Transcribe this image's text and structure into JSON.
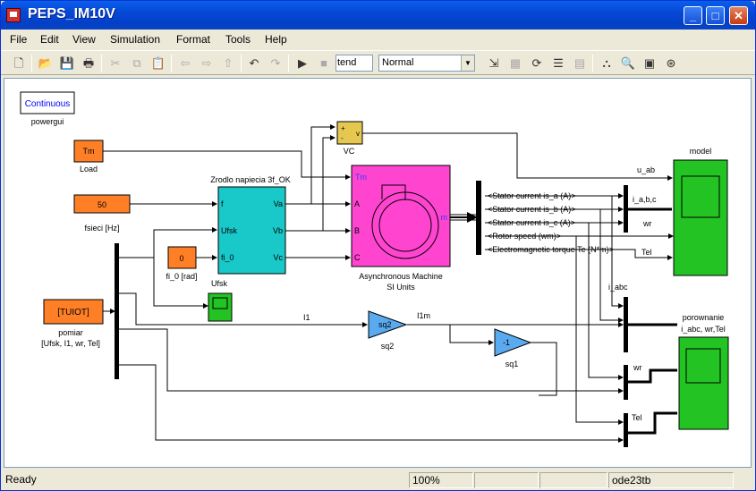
{
  "window": {
    "title": "PEPS_IM10V",
    "min_label": "_",
    "max_label": "□",
    "close_label": "✕"
  },
  "menu": [
    "File",
    "Edit",
    "View",
    "Simulation",
    "Format",
    "Tools",
    "Help"
  ],
  "toolbar": {
    "stop_time": "tend",
    "sim_mode": "Normal"
  },
  "blocks": {
    "powergui": {
      "text": "Continuous",
      "label": "powergui"
    },
    "load": {
      "text": "Tm",
      "label": "Load"
    },
    "fsieci": {
      "text": "50",
      "label": "fsieci [Hz]"
    },
    "fi0": {
      "text": "0",
      "label": "fi_0 [rad]"
    },
    "tuiot": {
      "text": "[TUIOT]",
      "label1": "pomiar",
      "label2": "[Ufsk, I1, wr, Tel]"
    },
    "vc": {
      "label": "VC",
      "plus": "+",
      "minus": "-",
      "v": "v"
    },
    "source": {
      "title": "Zrodlo napiecia 3f_OK",
      "in_f": "f",
      "in_ufsk": "Ufsk",
      "in_fi0": "fi_0",
      "out_va": "Va",
      "out_vb": "Vb",
      "out_vc": "Vc"
    },
    "machine": {
      "tm": "Tm",
      "a": "A",
      "b": "B",
      "c": "C",
      "m": "m",
      "label1": "Asynchronous Machine",
      "label2": "SI Units"
    },
    "ufsk_scope": {
      "label": "Ufsk"
    },
    "sq2": {
      "text": "sq2",
      "label": "sq2"
    },
    "sq1": {
      "text": "-1",
      "label": "sq1"
    },
    "model_scope": {
      "label": "model",
      "in1": "u_ab",
      "in2": "i_a,b,c",
      "in3": "wr",
      "in4": "Tel"
    },
    "por_scope": {
      "label1": "porownanie",
      "label2": "i_abc, wr,Tel"
    },
    "signals": {
      "s1": "<Stator current is_a (A)>",
      "s2": "<Stator current is_b (A)>",
      "s3": "<Stator current is_c (A)>",
      "s4": "<Rotor speed (wm)>",
      "s5": "<Electromagnetic torque Te (N*m)>",
      "i1": "I1",
      "i1m": "I1m",
      "iabc": "i_abc",
      "wr": "wr",
      "tel": "Tel"
    }
  },
  "status": {
    "ready": "Ready",
    "zoom": "100%",
    "solver": "ode23tb"
  },
  "colors": {
    "orange": "#ff7f27",
    "cyan": "#19c8c8",
    "magenta": "#ff44d0",
    "green": "#22c322",
    "blue_gain": "#5aaaf0",
    "vc_yellow": "#e6c850"
  }
}
